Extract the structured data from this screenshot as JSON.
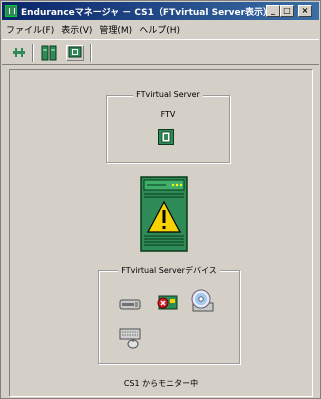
{
  "window": {
    "title": "Enduranceマネージャ － CS1（FTvirtual Server表示）",
    "buttons": {
      "minimize": "_",
      "maximize": "□",
      "close": "×"
    }
  },
  "menu": [
    "ファイル(F)",
    "表示(V)",
    "管理(M)",
    "ヘルプ(H)"
  ],
  "toolbar": {
    "buttons": [
      "connect-icon",
      "server-pair-icon",
      "monitor-icon"
    ]
  },
  "ftvirtual_group": {
    "label": "FTvirtual Server",
    "node": "FTV"
  },
  "devices_group": {
    "label": "FTvirtual Serverデバイス",
    "devices": [
      "network-adapter-icon",
      "storage-error-icon",
      "cdrom-icon",
      "keyboard-mouse-icon"
    ]
  },
  "status": "CS1 からモニター中",
  "colors": {
    "title_start": "#0a246a",
    "title_end": "#3a6ea5",
    "server_green": "#2e8b57",
    "warning_yellow": "#f5d200",
    "device_error": "#d0202a"
  }
}
